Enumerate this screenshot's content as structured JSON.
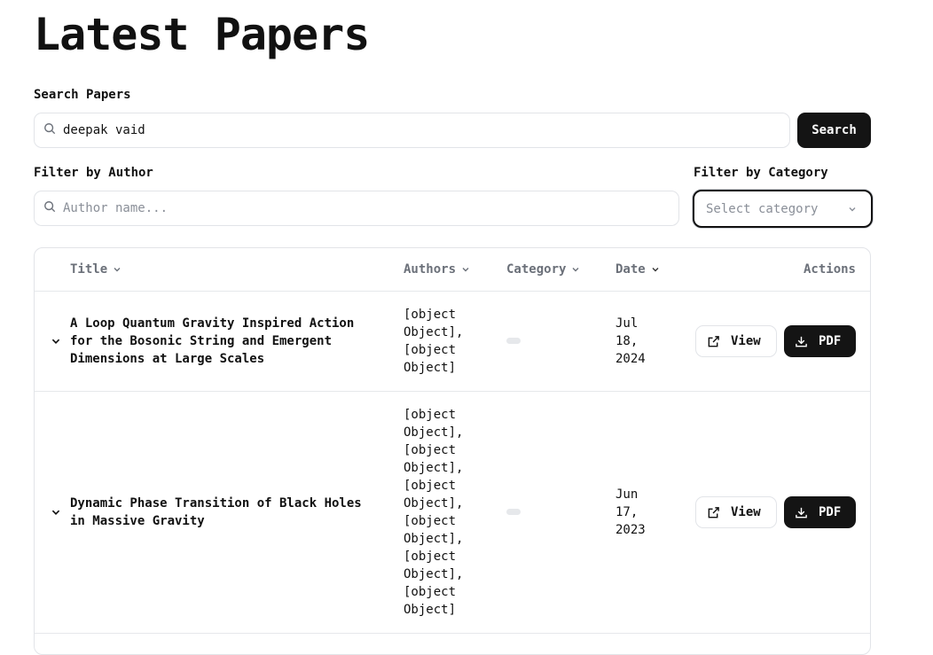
{
  "page": {
    "title": "Latest Papers"
  },
  "search": {
    "label": "Search Papers",
    "value": "deepak vaid",
    "button": "Search"
  },
  "author_filter": {
    "label": "Filter by Author",
    "placeholder": "Author name..."
  },
  "category_filter": {
    "label": "Filter by Category",
    "placeholder": "Select category"
  },
  "table": {
    "columns": {
      "title": "Title",
      "authors": "Authors",
      "category": "Category",
      "date": "Date",
      "actions": "Actions"
    },
    "rows": [
      {
        "title": [
          "A Loop Quantum Gravity Inspired Action",
          "for the Bosonic String and Emergent",
          "Dimensions at Large Scales"
        ],
        "authors": [
          "[object",
          "Object],",
          "[object",
          "Object]"
        ],
        "date": [
          "Jul",
          "18,",
          "2024"
        ],
        "view": "View",
        "pdf": "PDF"
      },
      {
        "title": [
          "Dynamic Phase Transition of Black Holes",
          "in Massive Gravity"
        ],
        "authors": [
          "[object",
          "Object],",
          "[object",
          "Object],",
          "[object",
          "Object],",
          "[object",
          "Object],",
          "[object",
          "Object],",
          "[object",
          "Object]"
        ],
        "date": [
          "Jun",
          "17,",
          "2023"
        ],
        "view": "View",
        "pdf": "PDF"
      }
    ]
  },
  "icons": {
    "search": "search-icon",
    "chevron": "chevron-down-icon",
    "external": "external-link-icon",
    "download": "download-icon"
  }
}
